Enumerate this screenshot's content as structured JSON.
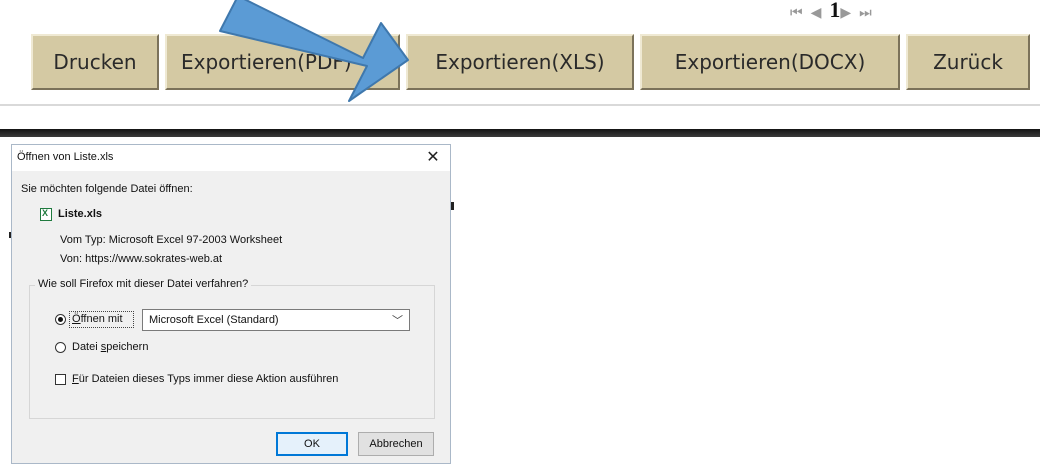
{
  "toolbar": {
    "buttons": [
      {
        "label": "Drucken"
      },
      {
        "label": "Exportieren(PDF)"
      },
      {
        "label": "Exportieren(XLS)"
      },
      {
        "label": "Exportieren(DOCX)"
      },
      {
        "label": "Zurück"
      }
    ]
  },
  "pager": {
    "page": "1"
  },
  "dialog": {
    "title": "Öffnen von Liste.xls",
    "close_glyph": "✕",
    "prompt": "Sie möchten folgende Datei öffnen:",
    "file_name": "Liste.xls",
    "type_label": "Vom Typ:",
    "type_value": "Microsoft Excel 97-2003 Worksheet",
    "from_label": "Von:",
    "from_value": "https://www.sokrates-web.at",
    "group_label": "Wie soll Firefox mit dieser Datei verfahren?",
    "open_with_label": "Öffnen mit",
    "open_with_value": "Microsoft Excel (Standard)",
    "save_label_pre": "Datei ",
    "save_label_key": "s",
    "save_label_post": "peichern",
    "always_label_key": "F",
    "always_label_post": "ür Dateien dieses Typs immer diese Aktion ausführen",
    "open_with_key": "Ö",
    "open_with_post": "ffnen mit",
    "ok_label": "OK",
    "cancel_label": "Abbrechen",
    "selected_action": "open"
  },
  "colors": {
    "toolbar_button": "#d4c9a3",
    "arrow": "#5b9bd5",
    "default_button_border": "#0078d7"
  }
}
